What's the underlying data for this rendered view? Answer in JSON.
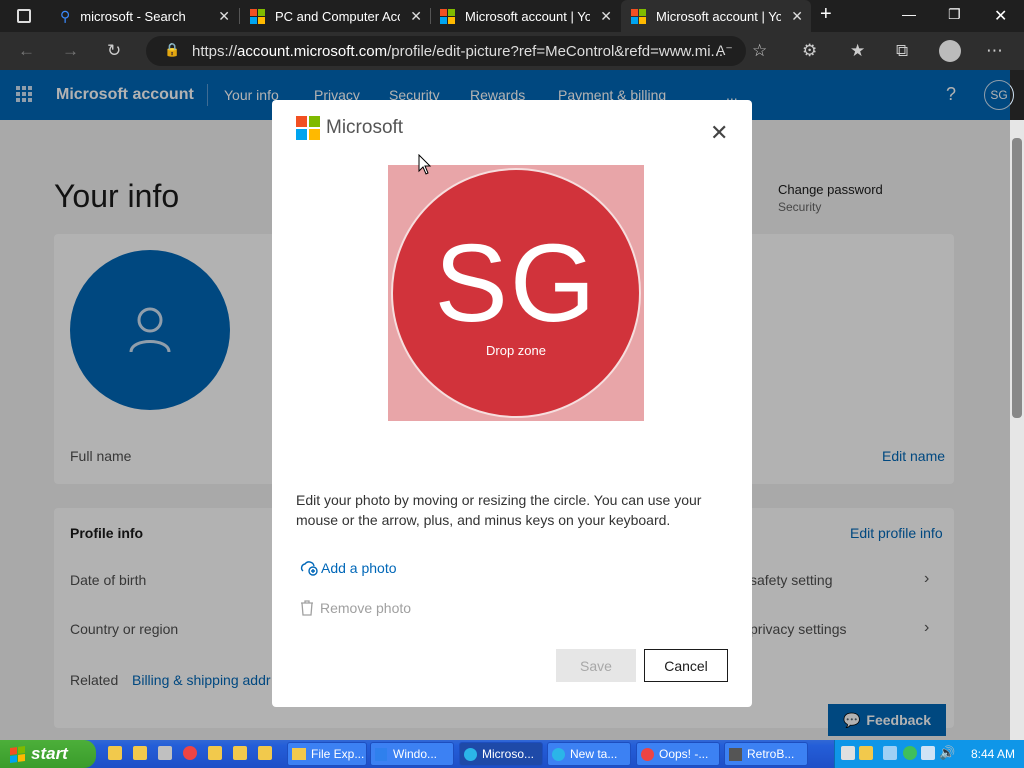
{
  "browser": {
    "tabs": [
      {
        "title": "microsoft - Search",
        "active": false
      },
      {
        "title": "PC and Computer Accessories",
        "active": false
      },
      {
        "title": "Microsoft account | Your info",
        "active": false
      },
      {
        "title": "Microsoft account | Your info",
        "active": true
      }
    ],
    "url_prefix": "https://",
    "url_host": "account.microsoft.com",
    "url_rest": "/profile/edit-picture?ref=MeControl&refd=www.mi..."
  },
  "msnav": {
    "brand": "Microsoft account",
    "links": [
      "Your info",
      "Privacy",
      "Security",
      "Rewards",
      "Payment & billing",
      "..."
    ],
    "help": "?",
    "avatar": "SG"
  },
  "page": {
    "title": "Your info",
    "change_password": "Change password",
    "change_password_sub": "Security",
    "full_name_label": "Full name",
    "edit_name": "Edit name",
    "profile_info": "Profile info",
    "edit_profile_info": "Edit profile info",
    "date_of_birth": "Date of birth",
    "country": "Country or region",
    "safety_setting": "safety setting",
    "privacy_settings": "privacy settings",
    "related": "Related",
    "billing": "Billing & shipping addr",
    "feedback": "Feedback"
  },
  "dialog": {
    "logo_text": "Microsoft",
    "initials": "SG",
    "drop_zone": "Drop zone",
    "description": "Edit your photo by moving or resizing the circle. You can use your mouse or the arrow, plus, and minus keys on your keyboard.",
    "add_photo": "Add a photo",
    "remove_photo": "Remove photo",
    "save": "Save",
    "cancel": "Cancel",
    "circle_color": "#d1333b",
    "backdrop_color": "#e8a5a8"
  },
  "taskbar": {
    "start": "start",
    "items": [
      "File Exp...",
      "Windo...",
      "Microso...",
      "New ta...",
      "Oops! -...",
      "RetroB..."
    ],
    "clock": "8:44 AM"
  }
}
